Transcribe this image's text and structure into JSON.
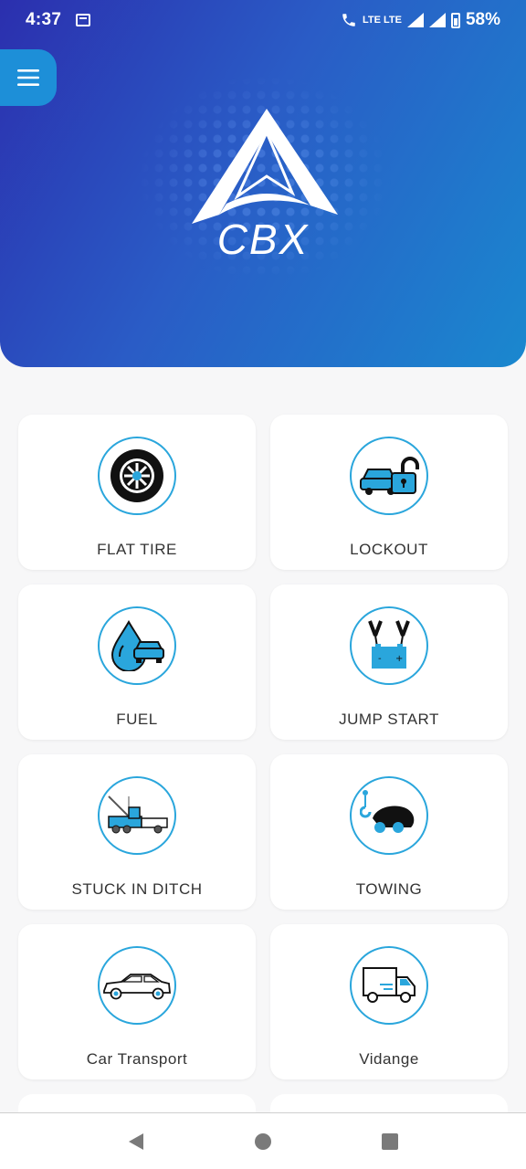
{
  "status_bar": {
    "time": "4:37",
    "network": "LTE LTE",
    "battery": "58%"
  },
  "header": {
    "logo_text": "CBX",
    "menu_icon": "hamburger-menu-icon"
  },
  "services": [
    {
      "label": "FLAT TIRE",
      "icon": "flat-tire-icon"
    },
    {
      "label": "LOCKOUT",
      "icon": "lockout-icon"
    },
    {
      "label": "FUEL",
      "icon": "fuel-icon"
    },
    {
      "label": "JUMP START",
      "icon": "jump-start-icon"
    },
    {
      "label": "STUCK IN DITCH",
      "icon": "stuck-in-ditch-icon"
    },
    {
      "label": "TOWING",
      "icon": "towing-icon"
    },
    {
      "label": "Car Transport",
      "icon": "car-transport-icon"
    },
    {
      "label": "Vidange",
      "icon": "vidange-icon"
    }
  ],
  "nav": {
    "back": "back-icon",
    "home": "home-icon",
    "recents": "recents-icon"
  },
  "colors": {
    "accent": "#1d8fd8",
    "icon_blue": "#2aa6dc",
    "header_start": "#2b2fae",
    "header_end": "#1a88cf"
  }
}
